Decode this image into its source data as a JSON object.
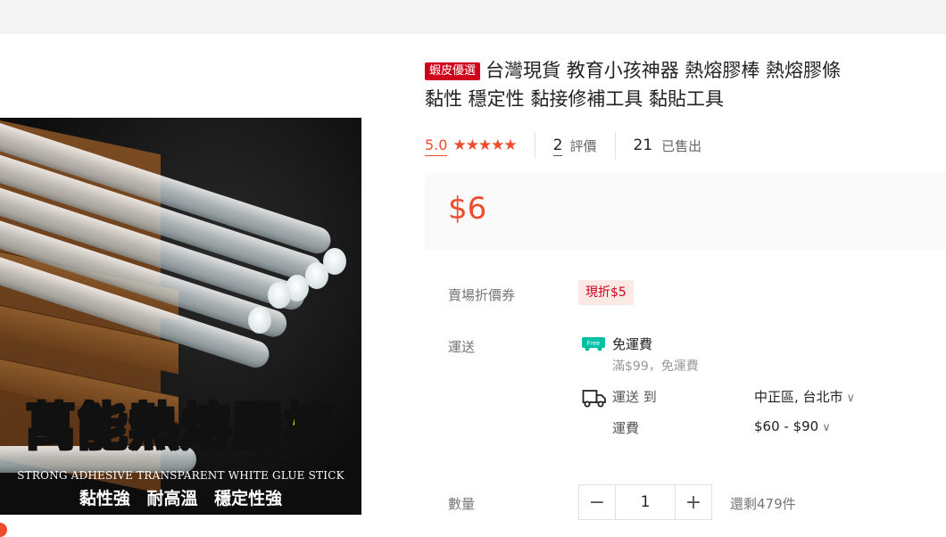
{
  "product": {
    "badge": "蝦皮優選",
    "title_line1": "台灣現貨 教育小孩神器 熱熔膠棒 熱熔膠條",
    "title_line2": "黏性 穩定性 黏接修補工具 黏貼工具",
    "image": {
      "headline": "萬能熱熔膠棒",
      "subline": "STRONG ADHESIVE TRANSPARENT WHITE GLUE STICK",
      "features": "黏性強 耐高溫 穩定性強"
    }
  },
  "rating": {
    "score": "5.0",
    "stars": "★★★★★",
    "review_count": "2",
    "review_label": "評價",
    "sold_count": "21",
    "sold_label": "已售出"
  },
  "price": "$6",
  "details": {
    "voucher_label": "賣場折價券",
    "voucher_value": "現折$5",
    "shipping_label": "運送",
    "free_icon_text": "Free",
    "free_shipping": "免運費",
    "free_condition": "滿$99，免運費",
    "ship_to_label": "運送 到",
    "ship_location": "中正區, 台北市",
    "ship_fee_label": "運費",
    "ship_fee": "$60 - $90"
  },
  "quantity": {
    "label": "數量",
    "minus": "−",
    "value": "1",
    "plus": "+",
    "stock": "還剩479件"
  },
  "colors": {
    "accent": "#ee4d2d",
    "badge": "#d0011b",
    "free_green": "#00bfa5"
  },
  "icons": [
    "star-icon",
    "free-shipping-icon",
    "truck-icon",
    "chevron-down-icon"
  ]
}
